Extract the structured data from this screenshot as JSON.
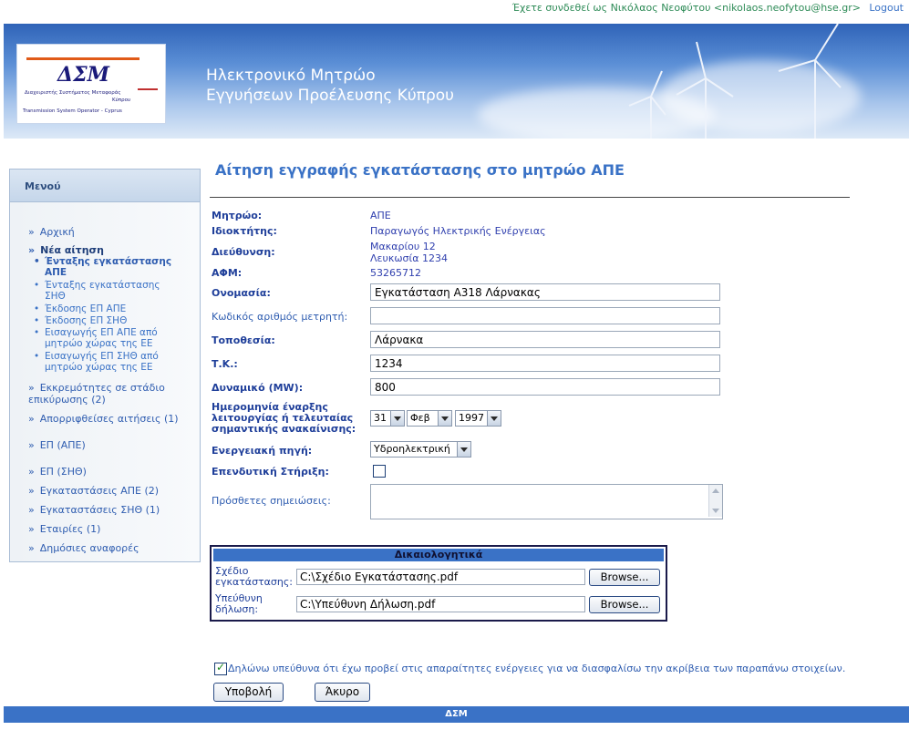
{
  "topbar": {
    "login_text": "Έχετε συνδεθεί ως Νικόλαος Νεοφύτου <nikolaos.neofytou@hse.gr>",
    "logout_label": "Logout"
  },
  "header": {
    "logo_text": "ΔΣΜ",
    "logo_sub1": "Διαχειριστής Συστήματος Μεταφοράς",
    "logo_sub2": "Κύπρου",
    "logo_sub3": "Transmission System Operator - Cyprus",
    "title_line1": "Ηλεκτρονικό Μητρώο",
    "title_line2": "Εγγυήσεων Προέλευσης Κύπρου"
  },
  "sidebar": {
    "title": "Μενού",
    "items": [
      {
        "label": "Αρχική"
      },
      {
        "label": "Νέα αίτηση"
      },
      {
        "label": "Εκκρεμότητες σε στάδιο επικύρωσης (2)"
      },
      {
        "label": "Απορριφθείσες αιτήσεις (1)"
      },
      {
        "label": "ΕΠ (ΑΠΕ)"
      },
      {
        "label": "ΕΠ (ΣΗΘ)"
      },
      {
        "label": "Εγκαταστάσεις ΑΠΕ (2)"
      },
      {
        "label": "Εγκαταστάσεις ΣΗΘ (1)"
      },
      {
        "label": "Εταιρίες (1)"
      },
      {
        "label": "Δημόσιες αναφορές"
      }
    ],
    "subitems": [
      {
        "line1": "Ένταξης εγκατάστασης",
        "line2": "ΑΠΕ"
      },
      {
        "line1": "Ένταξης εγκατάστασης",
        "line2": "ΣΗΘ"
      },
      {
        "line1": "Έκδοσης ΕΠ ΑΠΕ",
        "line2": ""
      },
      {
        "line1": "Έκδοσης ΕΠ ΣΗΘ",
        "line2": ""
      },
      {
        "line1": "Εισαγωγής ΕΠ ΑΠΕ από",
        "line2": "μητρώο χώρας της ΕΕ"
      },
      {
        "line1": "Εισαγωγής ΕΠ ΣΗΘ από",
        "line2": "μητρώο χώρας της ΕΕ"
      }
    ],
    "multi_line_labels": {
      "pending_line1": "Εκκρεμότητες σε στάδιο",
      "pending_line2": "επικύρωσης (2)"
    }
  },
  "main": {
    "title": "Αίτηση εγγραφής εγκατάστασης στο μητρώο ΑΠΕ",
    "fields": {
      "registry_label": "Μητρώο:",
      "registry_value": "ΑΠΕ",
      "owner_label": "Ιδιοκτήτης:",
      "owner_value": "Παραγωγός Ηλεκτρικής Ενέργειας",
      "address_label": "Διεύθυνση:",
      "address_line1": "Μακαρίου 12",
      "address_line2": "Λευκωσία 1234",
      "vat_label": "ΑΦΜ:",
      "vat_value": "53265712",
      "name_label": "Ονομασία:",
      "name_value": "Εγκατάσταση Α318 Λάρνακας",
      "meter_label": "Κωδικός αριθμός μετρητή:",
      "meter_value": "",
      "location_label": "Τοποθεσία:",
      "location_value": "Λάρνακα",
      "postcode_label": "Τ.Κ.:",
      "postcode_value": "1234",
      "capacity_label": "Δυναμικό (MW):",
      "capacity_value": "800",
      "start_date_label_line1": "Ημερομηνία έναρξης",
      "start_date_label_line2": "λειτουργίας ή τελευταίας",
      "start_date_label_line3": "σημαντικής ανακαίνισης:",
      "start_day": "31",
      "start_month": "Φεβ",
      "start_year": "1997",
      "energy_source_label": "Ενεργειακή πηγή:",
      "energy_source_value": "Υδροηλεκτρική",
      "investment_support_label": "Επενδυτική Στήριξη:",
      "notes_label": "Πρόσθετες σημειώσεις:"
    },
    "documents": {
      "title": "Δικαιολογητικά",
      "plan_label_line1": "Σχέδιο",
      "plan_label_line2": "εγκατάστασης:",
      "plan_file": "C:\\Σχέδιο Εγκατάστασης.pdf",
      "decl_label_line1": "Υπεύθυνη",
      "decl_label_line2": "δήλωση:",
      "decl_file": "C:\\Υπεύθυνη Δήλωση.pdf",
      "browse_label": "Browse..."
    },
    "declaration": "Δηλώνω υπεύθυνα ότι έχω προβεί στις απαραίτητες ενέργειες για να διασφαλίσω την ακρίβεια των παραπάνω στοιχείων.",
    "submit_label": "Υποβολή",
    "cancel_label": "Άκυρο"
  },
  "footer": {
    "text": "ΔΣΜ"
  },
  "colors": {
    "accent": "#3a72c6",
    "label": "#1f3f9a",
    "login_green": "#2e8b57"
  }
}
